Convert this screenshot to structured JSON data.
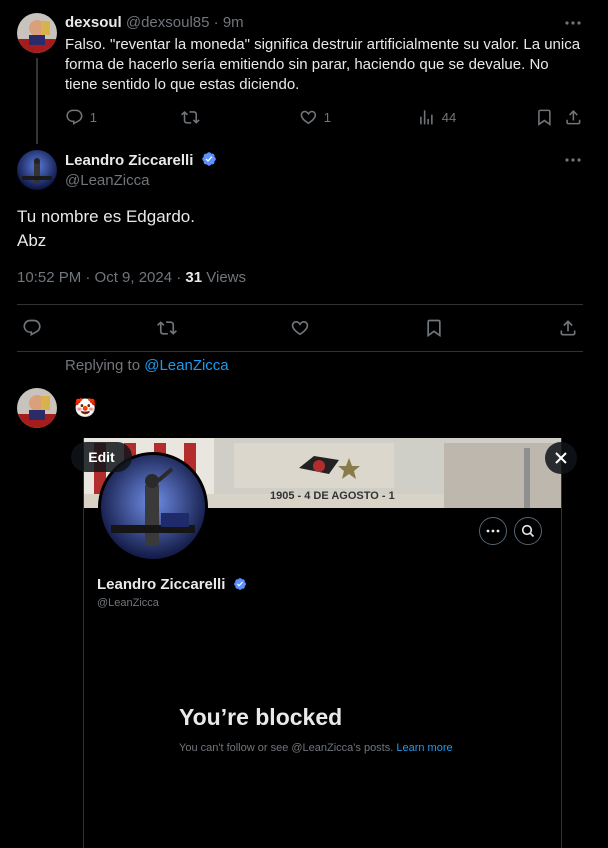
{
  "reply1": {
    "display_name": "dexsoul",
    "handle": "@dexsoul85",
    "sep": "·",
    "time": "9m",
    "text": "Falso. \"reventar la moneda\" significa destruir artificialmente su valor. La unica forma de hacerlo sería emitiendo sin parar, haciendo que se devalue. No tiene sentido lo que estas diciendo.",
    "reply_count": "1",
    "like_count": "1",
    "view_count": "44"
  },
  "main_tweet": {
    "display_name": "Leandro Ziccarelli",
    "handle": "@LeanZicca",
    "line1": "Tu nombre es Edgardo.",
    "line2": "Abz",
    "timestamp": "10:52 PM · Oct 9, 2024 · ",
    "views_count": "31",
    "views_label": " Views"
  },
  "reply2": {
    "replying_prefix": "Replying to ",
    "replying_handle": "@LeanZicca",
    "emoji": "🤡"
  },
  "embed": {
    "edit_label": "Edit",
    "banner_text": "1905 - 4 DE AGOSTO - 1",
    "profile_name": "Leandro Ziccarelli",
    "profile_handle": "@LeanZicca",
    "blocked_title": "You’re blocked",
    "blocked_text": "You can't follow or see @LeanZicca's posts. ",
    "learn_more": "Learn more"
  },
  "colors": {
    "accent": "#1d9bf0",
    "verified": "#5c91ff",
    "text": "#e7e9ea",
    "muted": "#71767b",
    "border": "#2f3336"
  }
}
